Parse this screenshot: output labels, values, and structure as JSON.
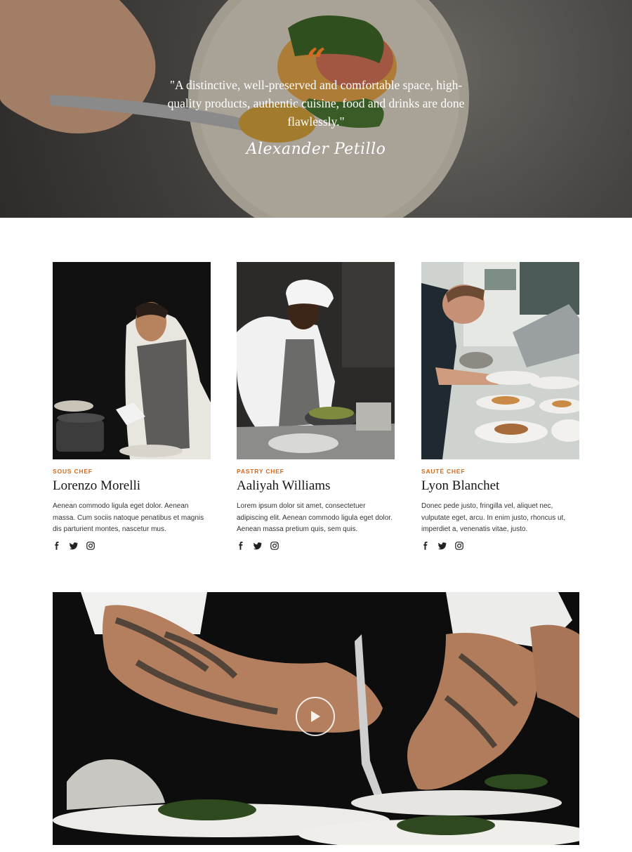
{
  "accent_color": "#d2691e",
  "testimonial": {
    "quote_mark": "“",
    "quote": "\"A distinctive, well-preserved and comfortable space, high-quality products, authentic cuisine, food and drinks are done flawlessly.\"",
    "author": "Alexander Petillo"
  },
  "team": [
    {
      "role": "Sous Chef",
      "name": "Lorenzo Morelli",
      "bio": "Aenean commodo ligula eget dolor. Aenean massa. Cum sociis natoque penatibus et magnis dis parturient montes, nascetur mus.",
      "social": [
        "facebook-icon",
        "twitter-icon",
        "instagram-icon"
      ]
    },
    {
      "role": "Pastry Chef",
      "name": "Aaliyah Williams",
      "bio": "Lorem ipsum dolor sit amet, consectetuer adipiscing elit. Aenean commodo ligula eget dolor. Aenean massa pretium quis, sem quis.",
      "social": [
        "facebook-icon",
        "twitter-icon",
        "instagram-icon"
      ]
    },
    {
      "role": "Sauté Chef",
      "name": "Lyon Blanchet",
      "bio": "Donec pede justo, fringilla vel, aliquet nec, vulputate eget, arcu. In enim justo, rhoncus ut, imperdiet a, venenatis vitae, justo.",
      "social": [
        "facebook-icon",
        "twitter-icon",
        "instagram-icon"
      ]
    }
  ],
  "video": {
    "icon": "play-icon"
  }
}
